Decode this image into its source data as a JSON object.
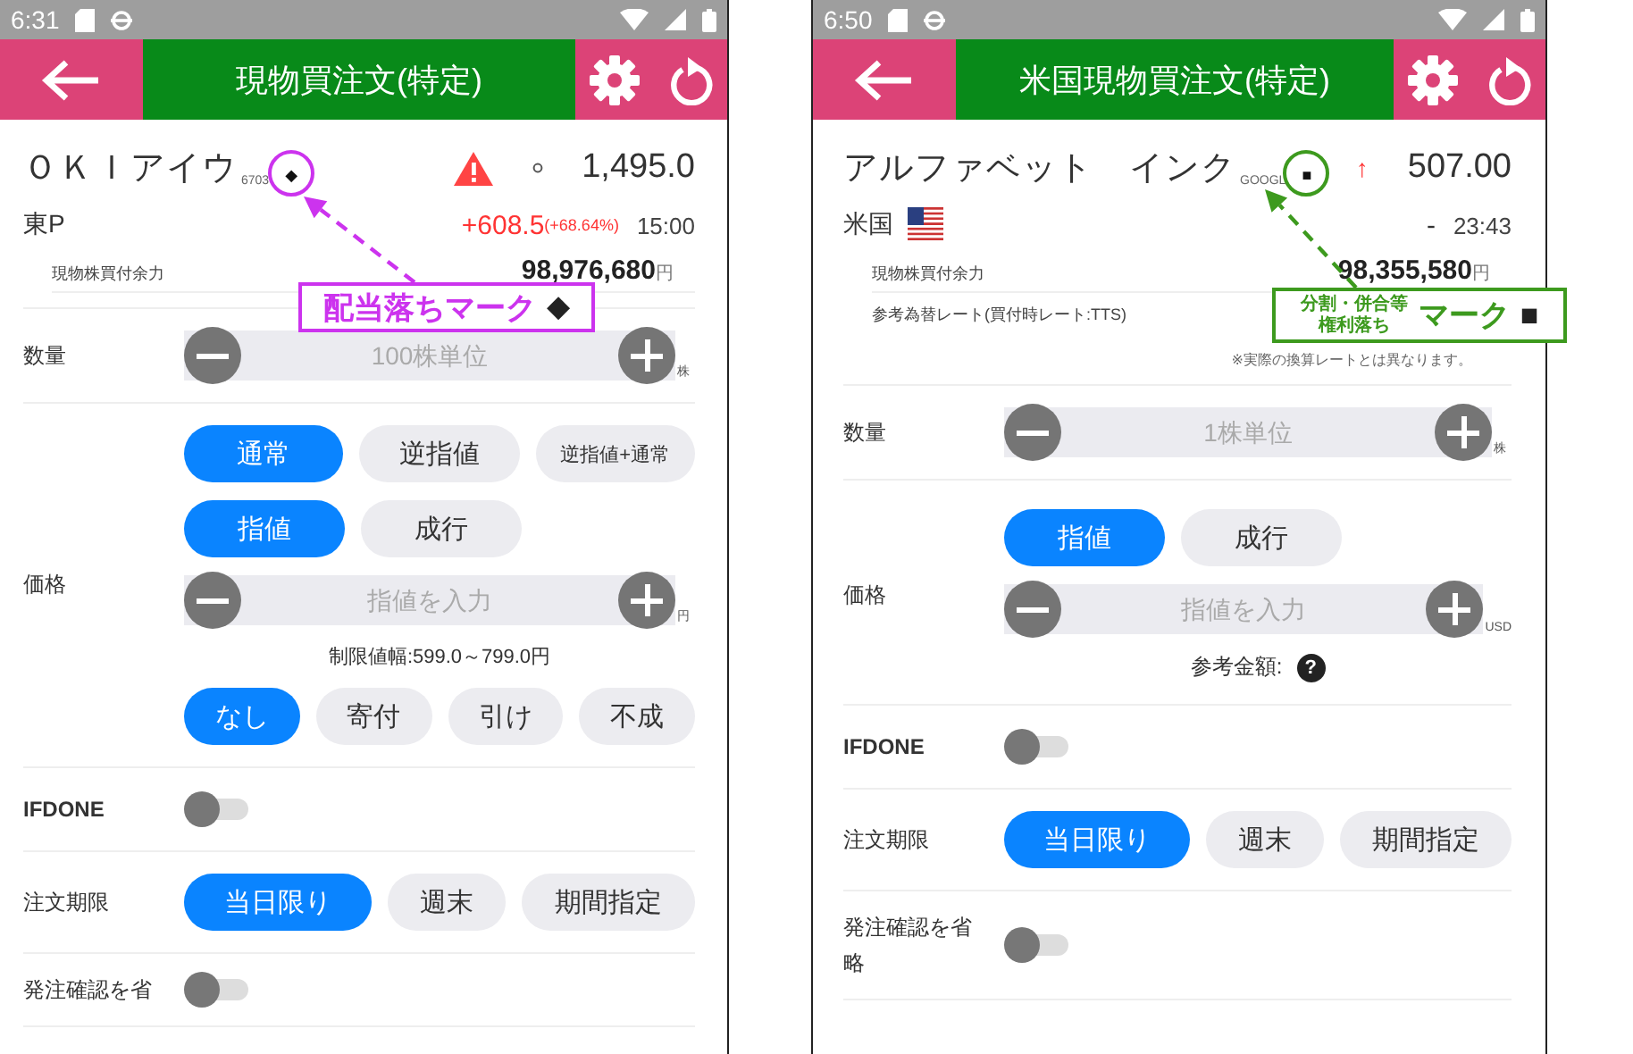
{
  "screens": [
    {
      "status_time": "6:31",
      "title": "現物買注文(特定)",
      "stock": {
        "name": "ＯＫＩアイウ",
        "code": "6703",
        "mark": "◆",
        "badges": [
          {
            "kind": "warning"
          },
          {
            "kind": "circle"
          }
        ],
        "price": "1,495.0",
        "market": "東P",
        "change": "+608.5",
        "change_pct": "(+68.64%)",
        "rising": true,
        "time": "15:00"
      },
      "info": [
        {
          "label": "現物株買付余力",
          "value": "98,976,680",
          "unit": "円"
        }
      ],
      "quantity": {
        "label": "数量",
        "placeholder": "100株単位",
        "unit": "株"
      },
      "price": {
        "label": "価格",
        "order_types": [
          {
            "label": "通常",
            "selected": true
          },
          {
            "label": "逆指値",
            "selected": false
          },
          {
            "label": "逆指値+通常",
            "selected": false
          }
        ],
        "price_types": [
          {
            "label": "指値",
            "selected": true
          },
          {
            "label": "成行",
            "selected": false
          }
        ],
        "placeholder": "指値を入力",
        "unit": "円",
        "limit": "制限値幅:599.0～799.0円",
        "conditions": [
          {
            "label": "なし",
            "selected": true
          },
          {
            "label": "寄付",
            "selected": false
          },
          {
            "label": "引け",
            "selected": false
          },
          {
            "label": "不成",
            "selected": false
          }
        ]
      },
      "ifdone": {
        "label": "IFDONE",
        "on": false
      },
      "period": {
        "label": "注文期限",
        "options": [
          {
            "label": "当日限り",
            "selected": true
          },
          {
            "label": "週末",
            "selected": false
          },
          {
            "label": "期間指定",
            "selected": false
          }
        ]
      },
      "skip_confirm": {
        "label": "発注確認を省",
        "on": false
      },
      "callout": {
        "text": "配当落ちマーク",
        "symbol": "◆",
        "color": "#cc33ee"
      }
    },
    {
      "status_time": "6:50",
      "title": "米国現物買注文(特定)",
      "stock": {
        "name": "アルファベット　インク",
        "code": "GOOGL",
        "mark": "■",
        "badges": [
          {
            "kind": "text",
            "text": "↑"
          }
        ],
        "price": "507.00",
        "market": "米国",
        "market_badges": [
          {
            "kind": "flag"
          }
        ],
        "change": "-",
        "rising": false,
        "time": "23:43"
      },
      "info": [
        {
          "label": "現物株買付余力",
          "value": "98,355,580",
          "unit": "円"
        },
        {
          "label": "参考為替レート(買付時レート:TTS)"
        }
      ],
      "note": "※実際の換算レートとは異なります。",
      "quantity": {
        "label": "数量",
        "placeholder": "1株単位",
        "unit": "株"
      },
      "price": {
        "label": "価格",
        "price_types": [
          {
            "label": "指値",
            "selected": true
          },
          {
            "label": "成行",
            "selected": false
          }
        ],
        "placeholder": "指値を入力",
        "unit": "USD",
        "reference": "参考金額:",
        "help": "?"
      },
      "ifdone": {
        "label": "IFDONE",
        "on": false
      },
      "period": {
        "label": "注文期限",
        "options": [
          {
            "label": "当日限り",
            "selected": true
          },
          {
            "label": "週末",
            "selected": false
          },
          {
            "label": "期間指定",
            "selected": false
          }
        ]
      },
      "skip_confirm": {
        "label": "発注確認を省略",
        "on": false
      },
      "callout": {
        "lines": [
          "分割・併合等",
          "権利落ち"
        ],
        "text": "マーク",
        "symbol": "■",
        "color": "#3d9a1e"
      }
    }
  ]
}
